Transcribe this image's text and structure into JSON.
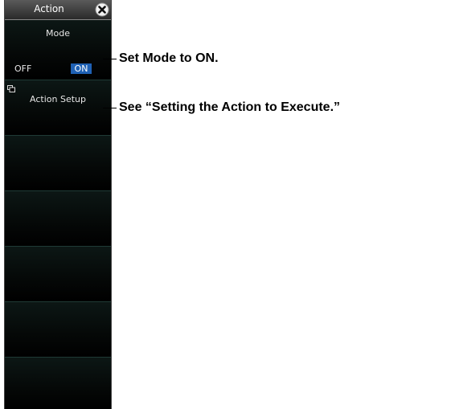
{
  "panel": {
    "title": "Action",
    "close_icon": "close-circle-icon",
    "mode": {
      "label": "Mode",
      "options": [
        "OFF",
        "ON"
      ],
      "selected": "ON",
      "selected_color": "#1f61b4"
    },
    "action_setup": {
      "label": "Action Setup",
      "icon": "submenu-icon"
    }
  },
  "callouts": {
    "mode": "Set Mode to ON.",
    "action_setup": "See “Setting the Action to Execute.”"
  }
}
